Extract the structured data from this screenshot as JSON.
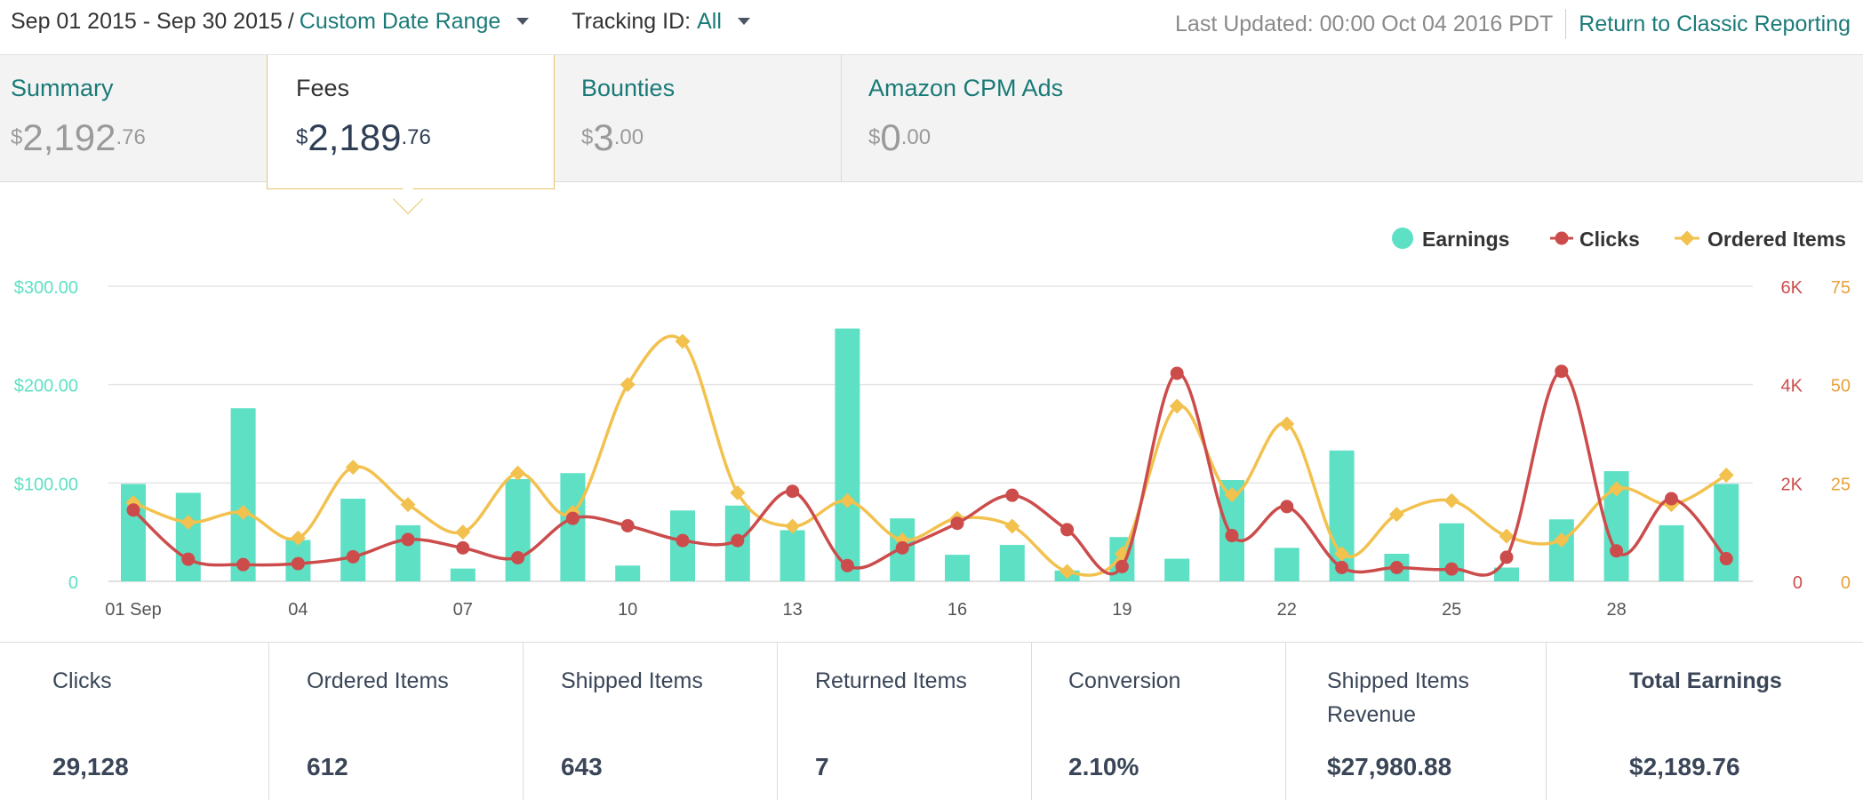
{
  "topbar": {
    "date_range": "Sep 01 2015 - Sep 30 2015",
    "separator": "/",
    "range_type": "Custom Date Range",
    "tracking_label": "Tracking ID:",
    "tracking_value": "All",
    "last_updated": "Last Updated: 00:00 Oct 04 2016 PDT",
    "classic_link": "Return to Classic Reporting"
  },
  "tabs": [
    {
      "name": "Summary",
      "currency": "$",
      "whole": "2,192",
      "cents": ".76"
    },
    {
      "name": "Fees",
      "currency": "$",
      "whole": "2,189",
      "cents": ".76"
    },
    {
      "name": "Bounties",
      "currency": "$",
      "whole": "3",
      "cents": ".00"
    },
    {
      "name": "Amazon CPM Ads",
      "currency": "$",
      "whole": "0",
      "cents": ".00"
    }
  ],
  "stats": [
    {
      "label": "Clicks",
      "value": "29,128"
    },
    {
      "label": "Ordered Items",
      "value": "612"
    },
    {
      "label": "Shipped Items",
      "value": "643"
    },
    {
      "label": "Returned Items",
      "value": "7"
    },
    {
      "label": "Conversion",
      "value": "2.10%"
    },
    {
      "label": "Shipped Items Revenue",
      "value": "$27,980.88"
    },
    {
      "label": "Total Earnings",
      "value": "$2,189.76"
    }
  ],
  "chart_data": {
    "type": "bar",
    "colors": {
      "earnings": "#5de0c4",
      "clicks": "#cc4c4c",
      "ordered": "#f2c14e",
      "grid": "#e4e4e4",
      "axis_text": "#555555"
    },
    "legend": [
      "Earnings",
      "Clicks",
      "Ordered Items"
    ],
    "legend_position": "top-right",
    "x_ticks": [
      "01 Sep",
      "04",
      "07",
      "10",
      "13",
      "16",
      "19",
      "22",
      "25",
      "28"
    ],
    "x_tick_days": [
      1,
      4,
      7,
      10,
      13,
      16,
      19,
      22,
      25,
      28
    ],
    "left_axis": {
      "ticks": [
        "0",
        "$100.00",
        "$200.00",
        "$300.00"
      ],
      "range": [
        0,
        300
      ]
    },
    "right_axis_clicks": {
      "ticks": [
        "0",
        "2K",
        "4K",
        "6K"
      ],
      "range": [
        0,
        6000
      ]
    },
    "right_axis_items": {
      "ticks": [
        "0",
        "25",
        "50",
        "75"
      ],
      "range": [
        0,
        75
      ]
    },
    "grid": true,
    "days": [
      1,
      2,
      3,
      4,
      5,
      6,
      7,
      8,
      9,
      10,
      11,
      12,
      13,
      14,
      15,
      16,
      17,
      18,
      19,
      20,
      21,
      22,
      23,
      24,
      25,
      26,
      27,
      28,
      29,
      30
    ],
    "series": [
      {
        "name": "Earnings",
        "axis": "left",
        "kind": "bar",
        "values": [
          99,
          90,
          176,
          42,
          84,
          57,
          13,
          104,
          110,
          16,
          72,
          77,
          52,
          257,
          64,
          27,
          37,
          11,
          45,
          23,
          103,
          34,
          133,
          28,
          59,
          14,
          63,
          112,
          57,
          99
        ]
      },
      {
        "name": "Clicks",
        "axis": "clicks",
        "kind": "line",
        "values": [
          1450,
          450,
          340,
          360,
          500,
          850,
          680,
          480,
          1280,
          1130,
          830,
          830,
          1830,
          320,
          680,
          1180,
          1750,
          1050,
          300,
          4230,
          930,
          1520,
          280,
          280,
          250,
          490,
          4270,
          620,
          1680,
          460
        ]
      },
      {
        "name": "Ordered Items",
        "axis": "items",
        "kind": "line",
        "values": [
          20,
          15,
          17.5,
          11,
          29,
          19.5,
          12.5,
          27.5,
          17.5,
          50,
          61,
          22.5,
          14,
          20.5,
          10.5,
          16,
          14,
          2.5,
          7,
          44.5,
          22,
          40,
          7,
          17,
          20.5,
          11.5,
          10.5,
          23.5,
          19.5,
          27
        ]
      }
    ]
  }
}
